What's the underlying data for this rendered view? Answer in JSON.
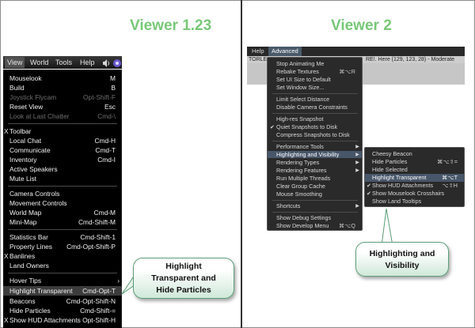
{
  "left_panel": {
    "title": "Viewer 1.23",
    "menubar": [
      {
        "label": "View",
        "active": true
      },
      {
        "label": "World",
        "active": false
      },
      {
        "label": "Tools",
        "active": false
      },
      {
        "label": "Help",
        "active": false
      }
    ],
    "menubar_icons": [
      "speaker-icon",
      "status-icon"
    ],
    "menu_items": [
      {
        "label": "Mouselook",
        "shortcut": "M",
        "check": false,
        "disabled": false,
        "highlighted": false
      },
      {
        "label": "Build",
        "shortcut": "B",
        "check": false,
        "disabled": false,
        "highlighted": false
      },
      {
        "label": "Joystick Flycam",
        "shortcut": "Opt-Shift-F",
        "check": false,
        "disabled": true,
        "highlighted": false
      },
      {
        "label": "Reset View",
        "shortcut": "Esc",
        "check": false,
        "disabled": false,
        "highlighted": false
      },
      {
        "label": "Look at Last Chatter",
        "shortcut": "Cmd-\\",
        "check": false,
        "disabled": true,
        "highlighted": false
      },
      {
        "label": "Toolbar",
        "shortcut": "",
        "check": true,
        "disabled": false,
        "highlighted": false
      },
      {
        "label": "Local Chat",
        "shortcut": "Cmd-H",
        "check": false,
        "disabled": false,
        "highlighted": false
      },
      {
        "label": "Communicate",
        "shortcut": "Cmd-T",
        "check": false,
        "disabled": false,
        "highlighted": false
      },
      {
        "label": "Inventory",
        "shortcut": "Cmd-I",
        "check": false,
        "disabled": false,
        "highlighted": false
      },
      {
        "label": "Active Speakers",
        "shortcut": "",
        "check": false,
        "disabled": false,
        "highlighted": false
      },
      {
        "label": "Mute List",
        "shortcut": "",
        "check": false,
        "disabled": false,
        "highlighted": false
      },
      {
        "label": "Camera Controls",
        "shortcut": "",
        "check": false,
        "disabled": false,
        "highlighted": false
      },
      {
        "label": "Movement Controls",
        "shortcut": "",
        "check": false,
        "disabled": false,
        "highlighted": false
      },
      {
        "label": "World Map",
        "shortcut": "Cmd-M",
        "check": false,
        "disabled": false,
        "highlighted": false
      },
      {
        "label": "Mini-Map",
        "shortcut": "Cmd-Shift-M",
        "check": false,
        "disabled": false,
        "highlighted": false
      },
      {
        "label": "Statistics Bar",
        "shortcut": "Cmd-Shift-1",
        "check": false,
        "disabled": false,
        "highlighted": false
      },
      {
        "label": "Property Lines",
        "shortcut": "Cmd-Opt-Shift-P",
        "check": false,
        "disabled": false,
        "highlighted": false
      },
      {
        "label": "Banlines",
        "shortcut": "",
        "check": true,
        "disabled": false,
        "highlighted": false
      },
      {
        "label": "Land Owners",
        "shortcut": "",
        "check": false,
        "disabled": false,
        "highlighted": false
      },
      {
        "label": "Hover Tips",
        "shortcut": "›",
        "check": false,
        "disabled": false,
        "highlighted": false
      },
      {
        "label": "Highlight Transparent",
        "shortcut": "Cmd-Opt-T",
        "check": false,
        "disabled": false,
        "highlighted": true
      },
      {
        "label": "Beacons",
        "shortcut": "Cmd-Opt-Shift-N",
        "check": false,
        "disabled": false,
        "highlighted": false
      },
      {
        "label": "Hide Particles",
        "shortcut": "Cmd-Shift-=",
        "check": false,
        "disabled": false,
        "highlighted": false
      },
      {
        "label": "Show HUD Attachments",
        "shortcut": "Opt-Shift-H",
        "check": true,
        "disabled": false,
        "highlighted": false
      }
    ],
    "callout": {
      "line1": "Highlight",
      "line2": "Transparent and",
      "line3": "Hide Particles"
    }
  },
  "right_panel": {
    "title": "Viewer 2",
    "menubar": [
      {
        "label": "Help",
        "active": false
      },
      {
        "label": "Advanced",
        "active": true
      }
    ],
    "status_left": "TORLE",
    "status_right": "RE!. Here (129, 123, 28) - Moderate",
    "menu_items": [
      {
        "label": "Stop Animating Me",
        "shortcut": "",
        "check": false,
        "arrow": false,
        "highlighted": false
      },
      {
        "label": "Rebake Textures",
        "shortcut": "⌘⌥R",
        "check": false,
        "arrow": false,
        "highlighted": false
      },
      {
        "label": "Set UI Size to Default",
        "shortcut": "",
        "check": false,
        "arrow": false,
        "highlighted": false
      },
      {
        "label": "Set Window Size...",
        "shortcut": "",
        "check": false,
        "arrow": false,
        "highlighted": false
      },
      {
        "label": "Limit Select Distance",
        "shortcut": "",
        "check": false,
        "arrow": false,
        "highlighted": false
      },
      {
        "label": "Disable Camera Constraints",
        "shortcut": "",
        "check": false,
        "arrow": false,
        "highlighted": false
      },
      {
        "label": "High-res Snapshot",
        "shortcut": "",
        "check": false,
        "arrow": false,
        "highlighted": false
      },
      {
        "label": "Quiet Snapshots to Disk",
        "shortcut": "",
        "check": true,
        "arrow": false,
        "highlighted": false
      },
      {
        "label": "Compress Snapshots to Disk",
        "shortcut": "",
        "check": false,
        "arrow": false,
        "highlighted": false
      },
      {
        "label": "Performance Tools",
        "shortcut": "",
        "check": false,
        "arrow": true,
        "highlighted": false
      },
      {
        "label": "Highlighting and Visibility",
        "shortcut": "",
        "check": false,
        "arrow": true,
        "highlighted": true
      },
      {
        "label": "Rendering Types",
        "shortcut": "",
        "check": false,
        "arrow": true,
        "highlighted": false
      },
      {
        "label": "Rendering Features",
        "shortcut": "",
        "check": false,
        "arrow": true,
        "highlighted": false
      },
      {
        "label": "Run Multiple Threads",
        "shortcut": "",
        "check": false,
        "arrow": false,
        "highlighted": false
      },
      {
        "label": "Clear Group Cache",
        "shortcut": "",
        "check": false,
        "arrow": false,
        "highlighted": false
      },
      {
        "label": "Mouse Smoothing",
        "shortcut": "",
        "check": false,
        "arrow": false,
        "highlighted": false
      },
      {
        "label": "Shortcuts",
        "shortcut": "",
        "check": false,
        "arrow": true,
        "highlighted": false
      },
      {
        "label": "Show Debug Settings",
        "shortcut": "",
        "check": false,
        "arrow": false,
        "highlighted": false
      },
      {
        "label": "Show Develop Menu",
        "shortcut": "⌘⌥Q",
        "check": false,
        "arrow": false,
        "highlighted": false
      }
    ],
    "submenu_items": [
      {
        "label": "Cheesy Beacon",
        "shortcut": "",
        "check": false,
        "highlighted": false
      },
      {
        "label": "Hide Particles",
        "shortcut": "⌘⌥⇧=",
        "check": false,
        "highlighted": false
      },
      {
        "label": "Hide Selected",
        "shortcut": "",
        "check": false,
        "highlighted": false
      },
      {
        "label": "Highlight Transparent",
        "shortcut": "⌘⌥T",
        "check": false,
        "highlighted": true
      },
      {
        "label": "Show HUD Attachments",
        "shortcut": "⌥⇧H",
        "check": true,
        "highlighted": false
      },
      {
        "label": "Show Mouselook Crosshairs",
        "shortcut": "",
        "check": true,
        "highlighted": false
      },
      {
        "label": "Show Land Tooltips",
        "shortcut": "",
        "check": false,
        "highlighted": false
      }
    ],
    "callout": {
      "line1": "Highlighting and",
      "line2": "Visibility"
    }
  },
  "colors": {
    "title_green": "#78c878",
    "highlight_blue": "#48566a",
    "callout_border": "#5c9e79"
  }
}
